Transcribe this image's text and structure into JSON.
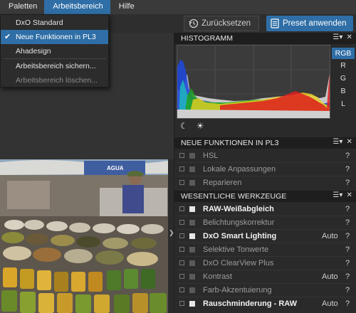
{
  "menubar": {
    "items": [
      "Paletten",
      "Arbeitsbereich",
      "Hilfe"
    ]
  },
  "toolbar": {
    "reset_label": "Zurücksetzen",
    "preset_label": "Preset anwenden"
  },
  "dropdown": {
    "items": [
      {
        "label": "DxO Standard"
      },
      {
        "label": "Neue Funktionen in PL3",
        "checked": true
      },
      {
        "label": "Ahadesign"
      },
      {
        "label": "Arbeitsbereich sichern..."
      },
      {
        "label": "Arbeitsbereich löschen...",
        "disabled": true
      }
    ]
  },
  "histogram": {
    "title": "HISTOGRAMM",
    "channels": [
      "RGB",
      "R",
      "G",
      "B",
      "L"
    ],
    "active_channel": "RGB"
  },
  "sections": [
    {
      "title": "NEUE FUNKTIONEN IN PL3",
      "rows": [
        {
          "label": "HSL",
          "auto": "",
          "help": "?"
        },
        {
          "label": "Lokale Anpassungen",
          "auto": "",
          "help": "?"
        },
        {
          "label": "Reparieren",
          "auto": "",
          "help": "?"
        }
      ]
    },
    {
      "title": "WESENTLICHE WERKZEUGE",
      "rows": [
        {
          "label": "RAW-Weißabgleich",
          "auto": "",
          "help": "?"
        },
        {
          "label": "Belichtungskorrektur",
          "auto": "",
          "help": "?"
        },
        {
          "label": "DxO Smart Lighting",
          "auto": "Auto",
          "help": "?"
        },
        {
          "label": "Selektive Tonwerte",
          "auto": "",
          "help": "?"
        },
        {
          "label": "DxO ClearView Plus",
          "auto": "",
          "help": "?"
        },
        {
          "label": "Kontrast",
          "auto": "Auto",
          "help": "?"
        },
        {
          "label": "Farb-Akzentuierung",
          "auto": "",
          "help": "?"
        },
        {
          "label": "Rauschminderung - RAW",
          "auto": "Auto",
          "help": "?"
        }
      ]
    }
  ],
  "photo": {
    "sign_text": "AGUA"
  },
  "colors": {
    "accent": "#2f6ea6",
    "panel_header": "#1e1e1e",
    "panel_bg": "#2a2a2a"
  }
}
